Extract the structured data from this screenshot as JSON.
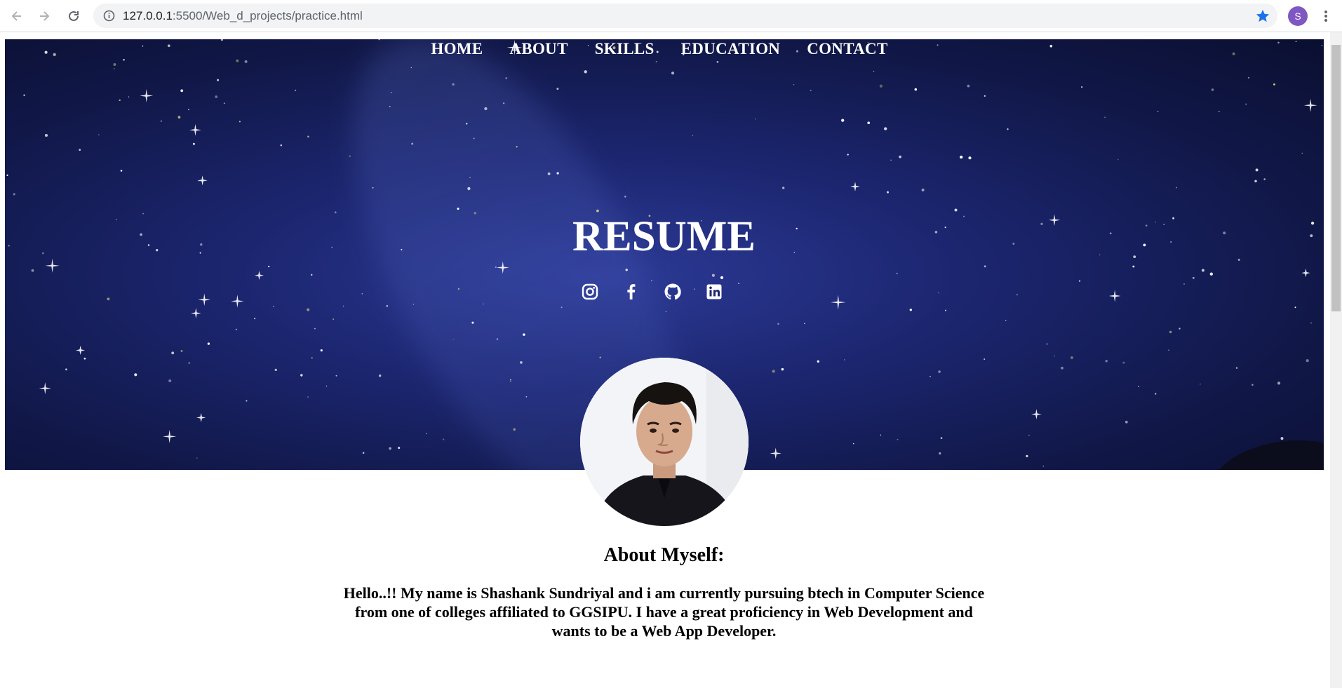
{
  "browser": {
    "url_host": "127.0.0.1",
    "url_rest": ":5500/Web_d_projects/practice.html",
    "profile_initial": "S",
    "accent": "#1a73e8",
    "profile_color": "#7e57c2"
  },
  "nav": {
    "items": [
      "HOME",
      "ABOUT",
      "SKILLS",
      "EDUCATION",
      "CONTACT"
    ]
  },
  "hero": {
    "title": "RESUME",
    "socials": [
      "instagram-icon",
      "facebook-icon",
      "github-icon",
      "linkedin-icon"
    ]
  },
  "about": {
    "title": "About Myself:",
    "text": "Hello..!! My name is Shashank Sundriyal and i am currently pursuing btech in Computer Science from one of colleges affiliated to GGSIPU. I have a great proficiency in Web Development and wants to be a Web App Developer."
  }
}
